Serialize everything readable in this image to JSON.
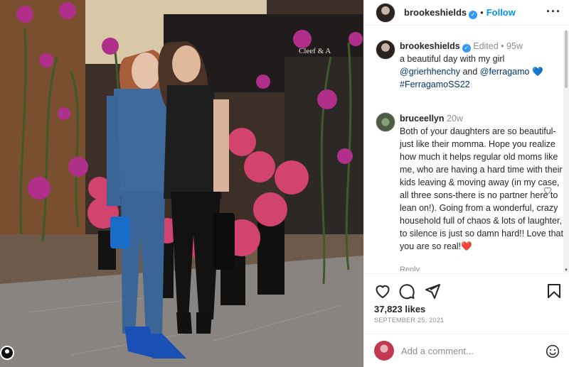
{
  "photo": {
    "alt_overlay_text": "Cleef & A"
  },
  "header": {
    "username": "brookeshields",
    "verified": true,
    "separator": "•",
    "follow_label": "Follow",
    "more_icon": "more-horizontal-icon"
  },
  "caption": {
    "username": "brookeshields",
    "edited": "Edited",
    "separator": "•",
    "age": "95w",
    "text_1": "a beautiful day with my girl",
    "mention_1": "@grierhhenchy",
    "and": "and",
    "mention_2": "@ferragamo",
    "heart": "💙",
    "hashtag": "#FerragamoSS22"
  },
  "comment": {
    "username": "bruceellyn",
    "age": "20w",
    "text": "Both of your daughters are so beautiful-just like their momma. Hope you realize how much it helps regular old moms like me, who are having a hard time with their kids leaving & moving away (in my case, all three sons-there is no partner here to lean on!). Going from a wonderful, crazy household full of chaos & lots of laughter, to silence is just so damn hard!! Love that you are so real!",
    "heart": "❤️",
    "reply_label": "Reply"
  },
  "actions": {
    "like_icon": "heart-outline-icon",
    "comment_icon": "comment-icon",
    "share_icon": "paper-plane-icon",
    "save_icon": "bookmark-icon"
  },
  "likes_text": "37,823 likes",
  "date_text": "SEPTEMBER 25, 2021",
  "add_comment": {
    "placeholder": "Add a comment..."
  },
  "colors": {
    "accent": "#0095f6",
    "verified": "#3897f0",
    "muted": "#8e8e8e",
    "text": "#262626"
  }
}
